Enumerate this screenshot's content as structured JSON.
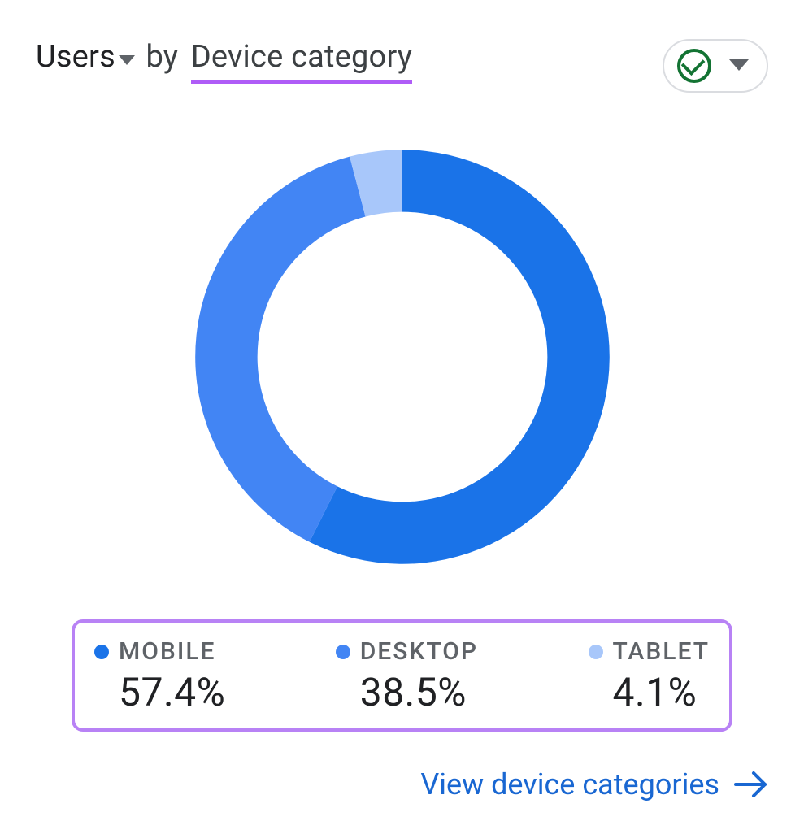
{
  "header": {
    "metric_label": "Users",
    "by_label": "by",
    "dimension_label": "Device category"
  },
  "status": {
    "icon": "check-circle-icon",
    "color": "#137333"
  },
  "legend": {
    "items": [
      {
        "label": "MOBILE",
        "value": "57.4%",
        "color": "#1a73e8"
      },
      {
        "label": "DESKTOP",
        "value": "38.5%",
        "color": "#4285f4"
      },
      {
        "label": "TABLET",
        "value": "4.1%",
        "color": "#a8c7fa"
      }
    ]
  },
  "footer": {
    "link_label": "View device categories"
  },
  "chart_data": {
    "type": "pie",
    "title": "Users by Device category",
    "series": [
      {
        "name": "MOBILE",
        "value": 57.4,
        "color": "#1a73e8"
      },
      {
        "name": "DESKTOP",
        "value": 38.5,
        "color": "#4285f4"
      },
      {
        "name": "TABLET",
        "value": 4.1,
        "color": "#a8c7fa"
      }
    ],
    "donut_inner_ratio": 0.7,
    "start_angle_deg": 0,
    "direction": "clockwise",
    "value_unit": "percent"
  }
}
